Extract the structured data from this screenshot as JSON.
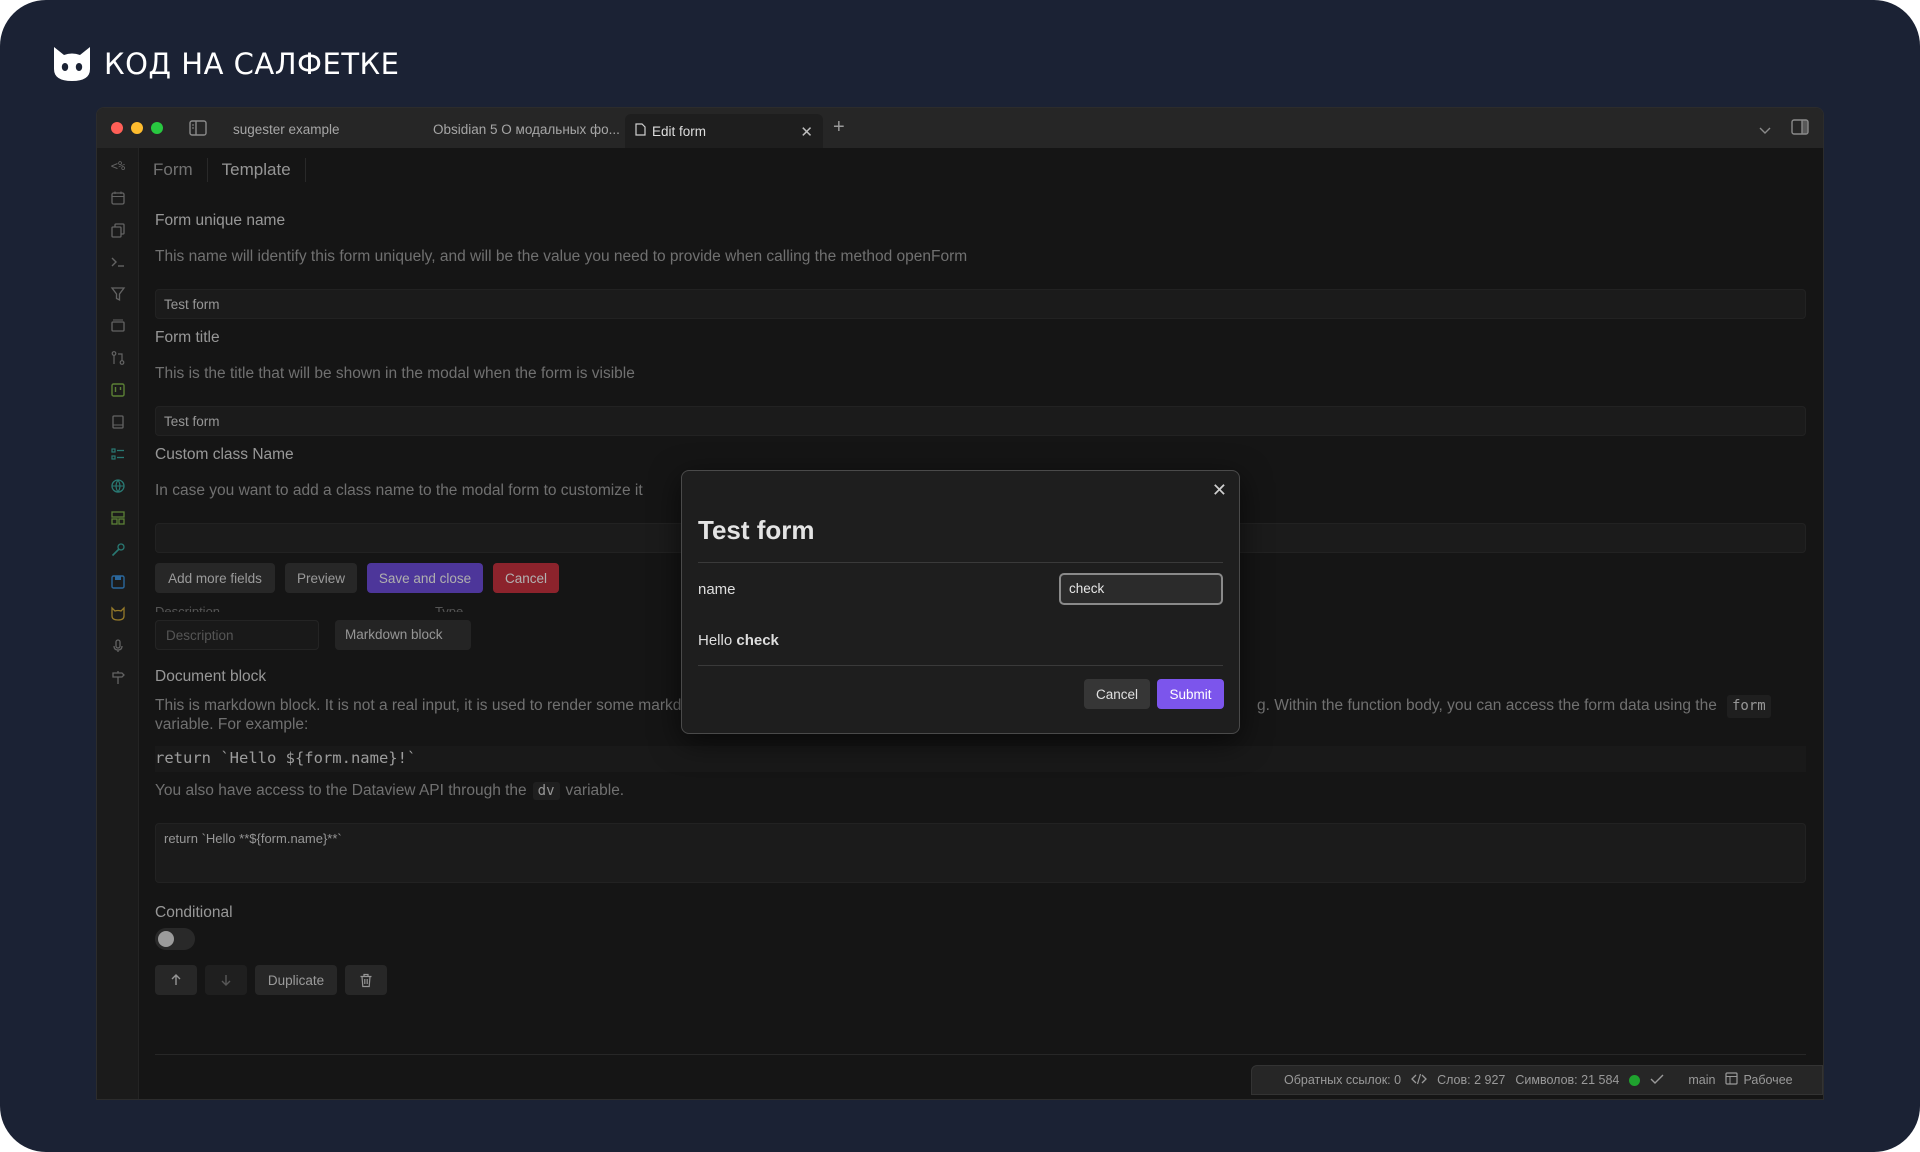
{
  "brand": {
    "text": "КОД НА САЛФЕТКЕ"
  },
  "tabs": [
    {
      "label": "sugester example"
    },
    {
      "label": "Obsidian 5 О модальных фо..."
    },
    {
      "label": "Edit form"
    }
  ],
  "form_tabs": [
    "Form",
    "Template"
  ],
  "fields": {
    "unique_name": {
      "title": "Form unique name",
      "desc": "This name will identify this form uniquely, and will be the value you need to provide when calling the method openForm",
      "value": "Test form"
    },
    "form_title": {
      "title": "Form title",
      "desc": "This is the title that will be shown in the modal when the form is visible",
      "value": "Test form"
    },
    "custom_class": {
      "title": "Custom class Name",
      "desc": "In case you want to add a class name to the modal form to customize it",
      "value": ""
    }
  },
  "buttons": {
    "add_more": "Add more fields",
    "preview": "Preview",
    "save_close": "Save and close",
    "cancel": "Cancel"
  },
  "field_editor": {
    "cut_label_left": "Description",
    "cut_label_right": "Type",
    "description_placeholder": "Description",
    "type_value": "Markdown block",
    "block_title": "Document block",
    "block_desc_1": "This is markdown block. It is not a real input, it is used to render some markd",
    "block_desc_2": "g. Within the function body, you can access the form data using the",
    "block_desc_code": "form",
    "block_desc_3": "variable. For example:",
    "example_code": "return `Hello ${form.name}!`",
    "dv_text_before": "You also have access to the Dataview API through the",
    "dv_code": "dv",
    "dv_text_after": "variable.",
    "textarea_value": "return `Hello **${form.name}**`",
    "conditional_label": "Conditional",
    "conditional_on": false,
    "duplicate_label": "Duplicate"
  },
  "modal": {
    "title": "Test form",
    "label": "name",
    "input_value": "check",
    "hello_prefix": "Hello ",
    "hello_name": "check",
    "cancel": "Cancel",
    "submit": "Submit"
  },
  "status": {
    "backlinks": "Обратных ссылок: 0",
    "words": "Слов: 2 927",
    "chars": "Символов: 21 584",
    "branch": "main",
    "workspace": "Рабочее"
  },
  "colors": {
    "accent": "#7c55ec",
    "danger": "#c2313d",
    "sync_ok": "#1fa22e"
  }
}
